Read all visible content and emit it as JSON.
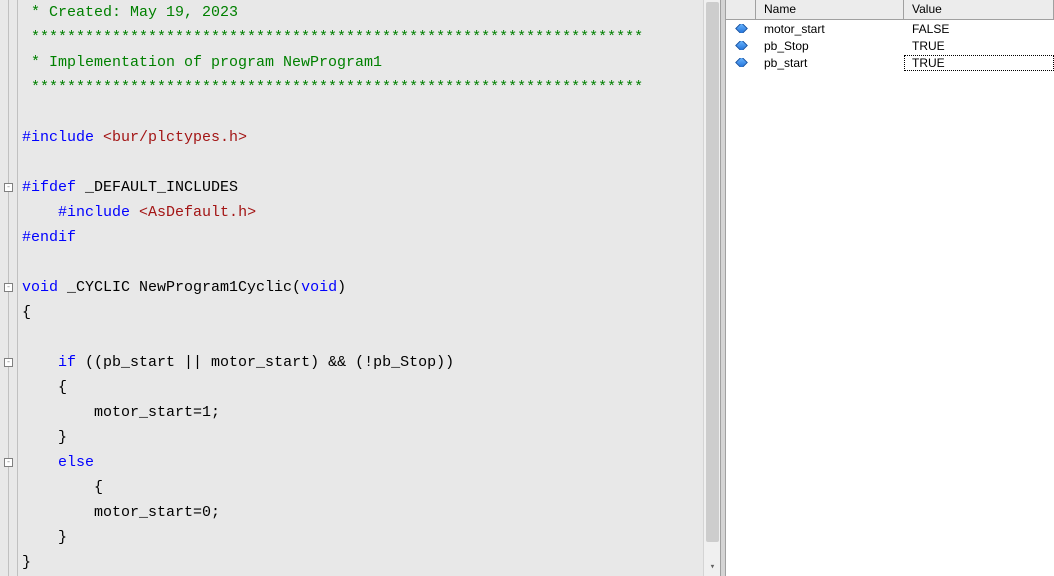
{
  "editor": {
    "lines": [
      {
        "segments": [
          {
            "cls": "c-green",
            "text": " * Created: May 19, 2023"
          }
        ]
      },
      {
        "segments": [
          {
            "cls": "c-green",
            "text": " ********************************************************************"
          }
        ]
      },
      {
        "segments": [
          {
            "cls": "c-green",
            "text": " * Implementation of program NewProgram1"
          }
        ]
      },
      {
        "segments": [
          {
            "cls": "c-green",
            "text": " ********************************************************************"
          }
        ]
      },
      {
        "segments": []
      },
      {
        "segments": [
          {
            "cls": "c-blue",
            "text": "#include"
          },
          {
            "cls": "c-black",
            "text": " "
          },
          {
            "cls": "c-maroon",
            "text": "<bur/plctypes.h>"
          }
        ]
      },
      {
        "segments": []
      },
      {
        "segments": [
          {
            "cls": "c-blue",
            "text": "#ifdef"
          },
          {
            "cls": "c-black",
            "text": " _DEFAULT_INCLUDES"
          }
        ],
        "fold": true
      },
      {
        "segments": [
          {
            "cls": "c-black",
            "text": "    "
          },
          {
            "cls": "c-blue",
            "text": "#include"
          },
          {
            "cls": "c-black",
            "text": " "
          },
          {
            "cls": "c-maroon",
            "text": "<AsDefault.h>"
          }
        ]
      },
      {
        "segments": [
          {
            "cls": "c-blue",
            "text": "#endif"
          }
        ]
      },
      {
        "segments": []
      },
      {
        "segments": [
          {
            "cls": "c-blue",
            "text": "void"
          },
          {
            "cls": "c-black",
            "text": " _CYCLIC NewProgram1Cyclic("
          },
          {
            "cls": "c-blue",
            "text": "void"
          },
          {
            "cls": "c-black",
            "text": ")"
          }
        ],
        "fold": true
      },
      {
        "segments": [
          {
            "cls": "c-black",
            "text": "{"
          }
        ]
      },
      {
        "segments": []
      },
      {
        "segments": [
          {
            "cls": "c-black",
            "text": "    "
          },
          {
            "cls": "c-blue",
            "text": "if"
          },
          {
            "cls": "c-black",
            "text": " ((pb_start || motor_start) && (!pb_Stop))"
          }
        ],
        "fold": true
      },
      {
        "segments": [
          {
            "cls": "c-black",
            "text": "    {"
          }
        ]
      },
      {
        "segments": [
          {
            "cls": "c-black",
            "text": "        motor_start=1;"
          }
        ]
      },
      {
        "segments": [
          {
            "cls": "c-black",
            "text": "    }"
          }
        ]
      },
      {
        "segments": [
          {
            "cls": "c-black",
            "text": "    "
          },
          {
            "cls": "c-blue",
            "text": "else"
          }
        ],
        "fold": true
      },
      {
        "segments": [
          {
            "cls": "c-black",
            "text": "        {"
          }
        ]
      },
      {
        "segments": [
          {
            "cls": "c-black",
            "text": "        motor_start=0;"
          }
        ]
      },
      {
        "segments": [
          {
            "cls": "c-black",
            "text": "    }"
          }
        ]
      },
      {
        "segments": [
          {
            "cls": "c-black",
            "text": "}"
          }
        ]
      }
    ]
  },
  "watch": {
    "header": {
      "name": "Name",
      "value": "Value"
    },
    "rows": [
      {
        "name": "motor_start",
        "value": "FALSE",
        "selected": false
      },
      {
        "name": "pb_Stop",
        "value": "TRUE",
        "selected": false
      },
      {
        "name": "pb_start",
        "value": "TRUE",
        "selected": true
      }
    ]
  }
}
